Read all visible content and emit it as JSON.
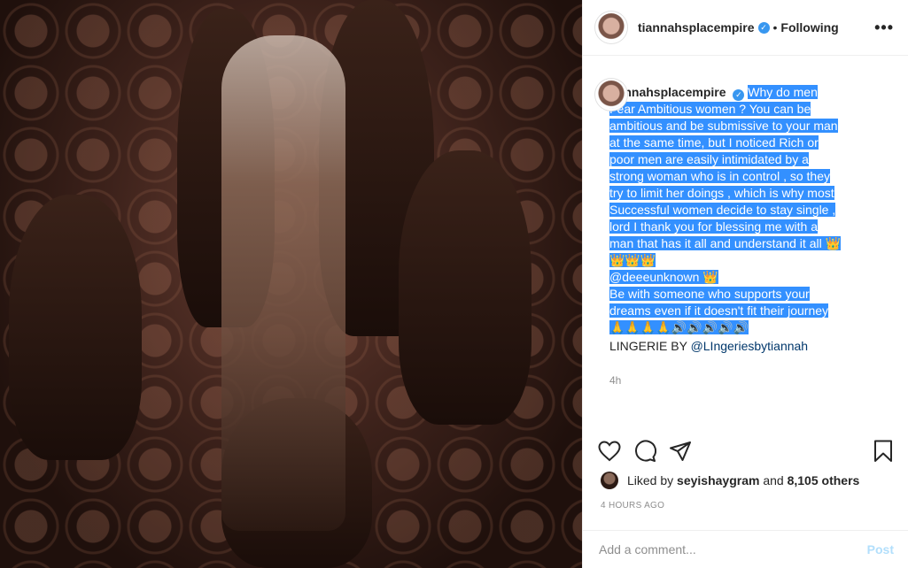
{
  "header": {
    "username": "tiannahsplacempire",
    "separator": "•",
    "follow_status": "Following",
    "more_label": "•••"
  },
  "caption": {
    "username": "tiannahsplacempire",
    "text_main": "Why do men Fear Ambitious women ? You can be ambitious and be submissive to your man at the same time, but I noticed Rich or poor men are easily intimidated by a strong woman who is in control , so they try to limit her doings , which is why most Successful women decide to stay single , lord I thank you for blessing me with a man that has it all and understand it all 👑 👑👑👑",
    "mention": "@deeeunknown",
    "mention_suffix": " 👑",
    "text_end": "Be with someone who supports your dreams even if it doesn't fit their journey 🙏🙏🙏🙏🔊🔊🔊🔊🔊",
    "lingerie_prefix": "LINGERIE BY ",
    "lingerie_mention": "@LIngeriesbytiannah",
    "time": "4h"
  },
  "likes": {
    "prefix": "Liked by ",
    "user": "seyishaygram",
    "middle": " and ",
    "count": "8,105 others"
  },
  "posted_ago": "4 HOURS AGO",
  "comment": {
    "placeholder": "Add a comment...",
    "post_label": "Post"
  },
  "icons": [
    "heart-icon",
    "comment-icon",
    "share-icon",
    "bookmark-icon",
    "verified-icon"
  ],
  "colors": {
    "highlight": "#3390ff",
    "verified": "#3897f0",
    "post_button": "#b2dffc"
  }
}
